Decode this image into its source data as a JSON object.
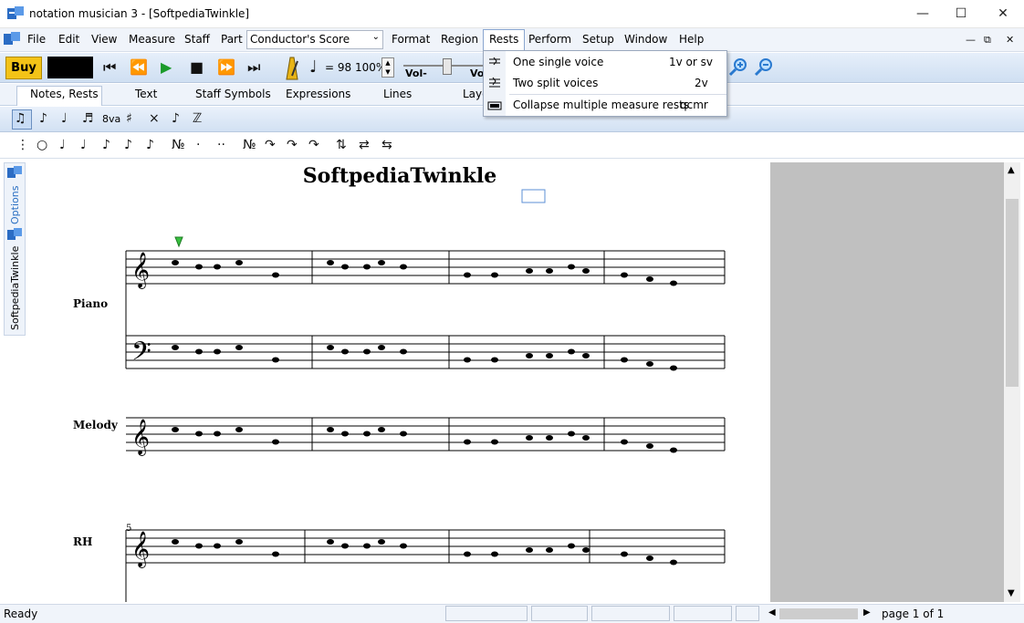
{
  "window": {
    "title": "notation musician 3 - [SoftpediaTwinkle]"
  },
  "menubar": {
    "items": [
      "File",
      "Edit",
      "View",
      "Measure",
      "Staff",
      "Part",
      "Format",
      "Region",
      "Rests",
      "Perform",
      "Setup",
      "Window",
      "Help"
    ],
    "part_select": "Conductor's Score"
  },
  "toolbar": {
    "buy_label": "Buy",
    "tempo": "= 98",
    "zoom": "100%",
    "vol_label": "Vol-",
    "vol2_label": "Vo"
  },
  "tabs": [
    "Notes, Rests",
    "Text",
    "Staff Symbols",
    "Expressions",
    "Lines",
    "Layo"
  ],
  "toolbar2": {
    "octave_label": "8va"
  },
  "side_panel": {
    "options_label": "Options",
    "doc_label": "SoftpediaTwinkle"
  },
  "rests_menu": {
    "items": [
      {
        "label": "One single voice",
        "shortcut": "1v or sv"
      },
      {
        "label": "Two split voices",
        "shortcut": "2v"
      },
      {
        "label": "Collapse multiple measure rests",
        "shortcut": "qcmr"
      }
    ]
  },
  "score": {
    "title": "SoftpediaTwinkle",
    "staff_labels": [
      "Piano",
      "Melody",
      "RH"
    ],
    "measure_number": "5"
  },
  "status": {
    "left": "Ready",
    "page": "page 1 of 1"
  }
}
